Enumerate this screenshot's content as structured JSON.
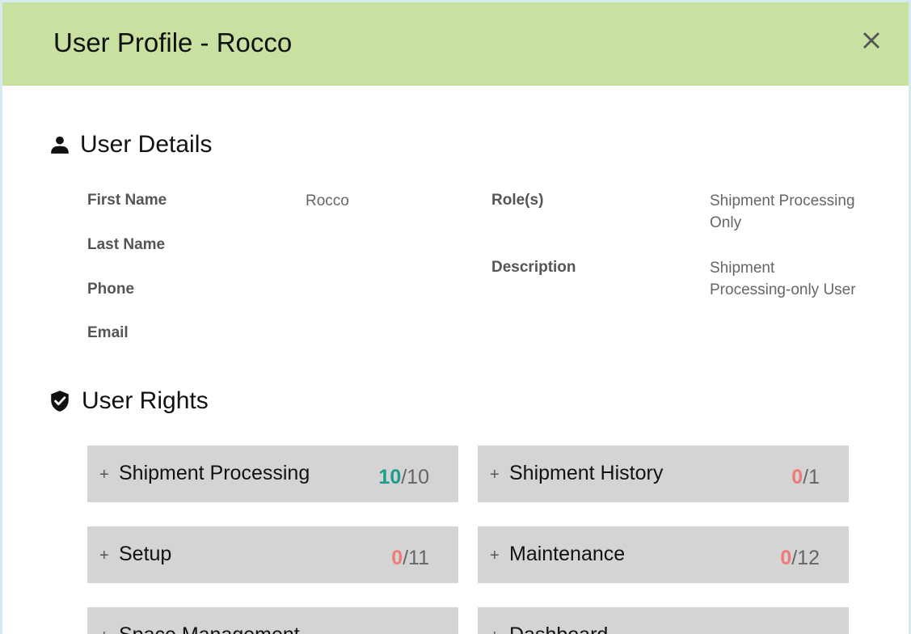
{
  "header": {
    "title": "User Profile - Rocco"
  },
  "user_details": {
    "title": "User Details",
    "first_name_label": "First Name",
    "first_name_value": "Rocco",
    "last_name_label": "Last Name",
    "last_name_value": "",
    "phone_label": "Phone",
    "phone_value": "",
    "email_label": "Email",
    "email_value": "",
    "roles_label": "Role(s)",
    "roles_value_line1": "Shipment Processing",
    "roles_value_line2": "Only",
    "description_label": "Description",
    "description_value_line1": "Shipment",
    "description_value_line2": "Processing-only User"
  },
  "user_rights": {
    "title": "User Rights",
    "groups": [
      {
        "name": "Shipment Processing",
        "granted": "10",
        "total": "/10",
        "status_color": "#1a9d8a"
      },
      {
        "name": "Shipment History",
        "granted": "0",
        "total": "/1",
        "status_color": "#f07a7a"
      },
      {
        "name": "Setup",
        "granted": "0",
        "total": "/11",
        "status_color": "#f07a7a"
      },
      {
        "name": "Maintenance",
        "granted": "0",
        "total": "/12",
        "status_color": "#f07a7a"
      },
      {
        "name": "Space Management",
        "granted": "",
        "total": ""
      },
      {
        "name": "Dashboard",
        "granted": "",
        "total": ""
      }
    ],
    "expand_symbol": "+"
  },
  "colors": {
    "header_bg": "#c8e0a0",
    "card_bg": "#d4d4d4",
    "granted_full": "#1a9d8a",
    "granted_none": "#f07a7a"
  },
  "icons": {
    "close": "close-icon",
    "user_details": "person-icon",
    "user_rights": "shield-check-icon"
  }
}
